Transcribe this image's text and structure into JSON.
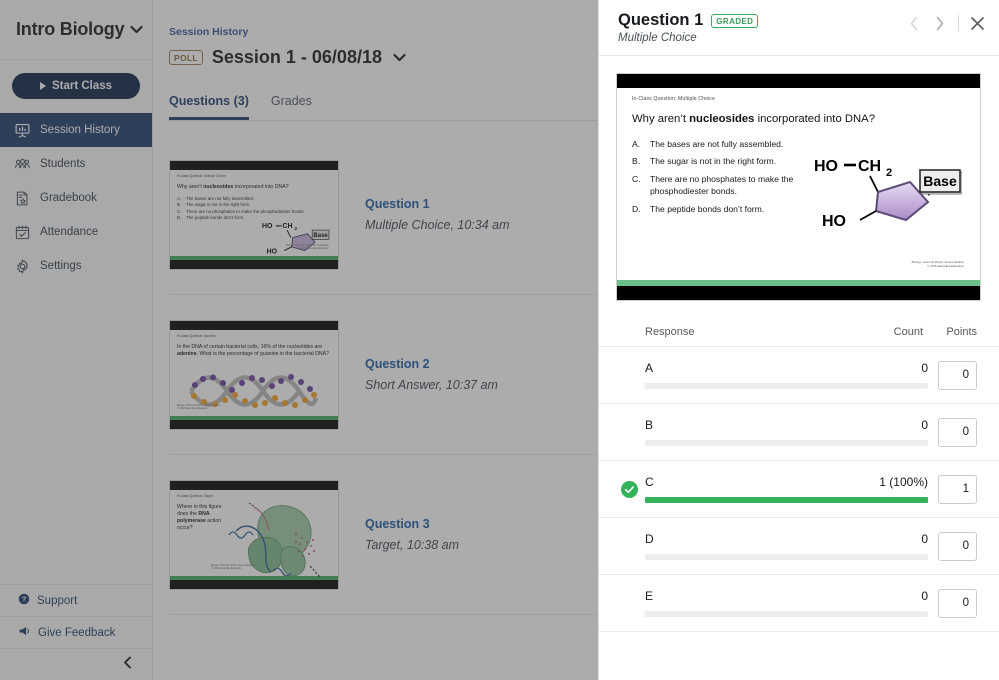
{
  "sidebar": {
    "brand_title": "Intro Biology",
    "brand_caret": "⌄",
    "start_class_label": "Start Class",
    "items": [
      {
        "label": "Session History",
        "icon": "presentation-icon",
        "active": true
      },
      {
        "label": "Students",
        "icon": "people-icon",
        "active": false
      },
      {
        "label": "Gradebook",
        "icon": "gradebook-icon",
        "active": false
      },
      {
        "label": "Attendance",
        "icon": "calendar-check-icon",
        "active": false
      },
      {
        "label": "Settings",
        "icon": "gear-icon",
        "active": false
      }
    ],
    "footer": [
      {
        "label": "Support",
        "icon": "help-circle-icon"
      },
      {
        "label": "Give Feedback",
        "icon": "megaphone-icon"
      }
    ],
    "collapse_icon": "chevron-left-icon"
  },
  "main": {
    "breadcrumb": "Session History",
    "poll_badge": "POLL",
    "session_title": "Session 1 - 06/08/18",
    "session_caret": "⌄",
    "tabs": [
      {
        "label": "Questions (3)",
        "active": true
      },
      {
        "label": "Grades",
        "active": false
      }
    ],
    "questions": [
      {
        "title": "Question 1",
        "meta": "Multiple Choice, 10:34 am",
        "slide": {
          "kicker": "In-Class Question: Multiple Choice",
          "prompt_pre": "Why aren’t ",
          "prompt_bold": "nucleosides",
          "prompt_post": " incorporated into DNA?",
          "options": [
            {
              "letter": "A.",
              "text": "The bases are not fully assembled."
            },
            {
              "letter": "B.",
              "text": "The sugar is not in the right form."
            },
            {
              "letter": "C.",
              "text": "There are no phosphates to make the phosphodiester bonds."
            },
            {
              "letter": "D.",
              "text": "The peptide bonds don’t form."
            }
          ],
          "attrib_line1": "Biology: How Life Works, Second Edition",
          "attrib_line2": "© 2016 Macmillan Education"
        }
      },
      {
        "title": "Question 2",
        "meta": "Short Answer, 10:37 am",
        "slide": {
          "kicker": "In-Class Question: Numeric",
          "prompt_pre": "In the DNA of certain bacterial cells, 16% of the nucleotides are ",
          "prompt_bold": "adenine",
          "prompt_post": ". What is the percentage of guanine in the bacterial DNA?",
          "attrib_line1": "Biology: How Life Works, Second Edition",
          "attrib_line2": "© 2016 Macmillan Education"
        }
      },
      {
        "title": "Question 3",
        "meta": "Target, 10:38 am",
        "slide": {
          "kicker": "In-Class Question: Target",
          "prompt_pre": "Where in this figure does the ",
          "prompt_bold": "RNA polymerase",
          "prompt_post": " action occur?",
          "attrib_line1": "Biology: How Life Works, Second Edition",
          "attrib_line2": "© 2016 Macmillan Education"
        }
      }
    ]
  },
  "panel": {
    "title": "Question 1",
    "status_badge": "GRADED",
    "subtitle": "Multiple Choice",
    "nav": {
      "prev_icon": "chevron-left-icon",
      "next_icon": "chevron-right-icon",
      "close_icon": "close-icon"
    },
    "slide": {
      "kicker": "In-Class Question: Multiple Choice",
      "prompt_pre": "Why aren’t ",
      "prompt_bold": "nucleosides",
      "prompt_post": " incorporated into DNA?",
      "options": [
        {
          "letter": "A.",
          "text": "The bases are not fully assembled."
        },
        {
          "letter": "B.",
          "text": "The sugar is not in the right form."
        },
        {
          "letter": "C.",
          "text": "There are no phosphates to make the phosphodiester bonds."
        },
        {
          "letter": "D.",
          "text": "The peptide bonds don’t form."
        }
      ],
      "molecule": {
        "ho_top": "HO",
        "ch2": "CH",
        "ch2_sub": "2",
        "ho_bottom": "HO",
        "base_label": "Base"
      },
      "attrib_line1": "Biology: How Life Works, Second Edition",
      "attrib_line2": "© 2016 Macmillan Education"
    },
    "table": {
      "headers": {
        "response": "Response",
        "count": "Count",
        "points": "Points"
      },
      "rows": [
        {
          "letter": "A",
          "count_text": "0",
          "percent": 0,
          "points": "0",
          "correct": false
        },
        {
          "letter": "B",
          "count_text": "0",
          "percent": 0,
          "points": "0",
          "correct": false
        },
        {
          "letter": "C",
          "count_text": "1 (100%)",
          "percent": 100,
          "points": "1",
          "correct": true
        },
        {
          "letter": "D",
          "count_text": "0",
          "percent": 0,
          "points": "0",
          "correct": false
        },
        {
          "letter": "E",
          "count_text": "0",
          "percent": 0,
          "points": "0",
          "correct": false
        }
      ]
    }
  },
  "colors": {
    "brand_navy": "#0a1f44",
    "active_navy": "#1b3a6b",
    "link_blue": "#1b5a9c",
    "green": "#34b35a",
    "badge_brown": "#8a6b3d"
  }
}
